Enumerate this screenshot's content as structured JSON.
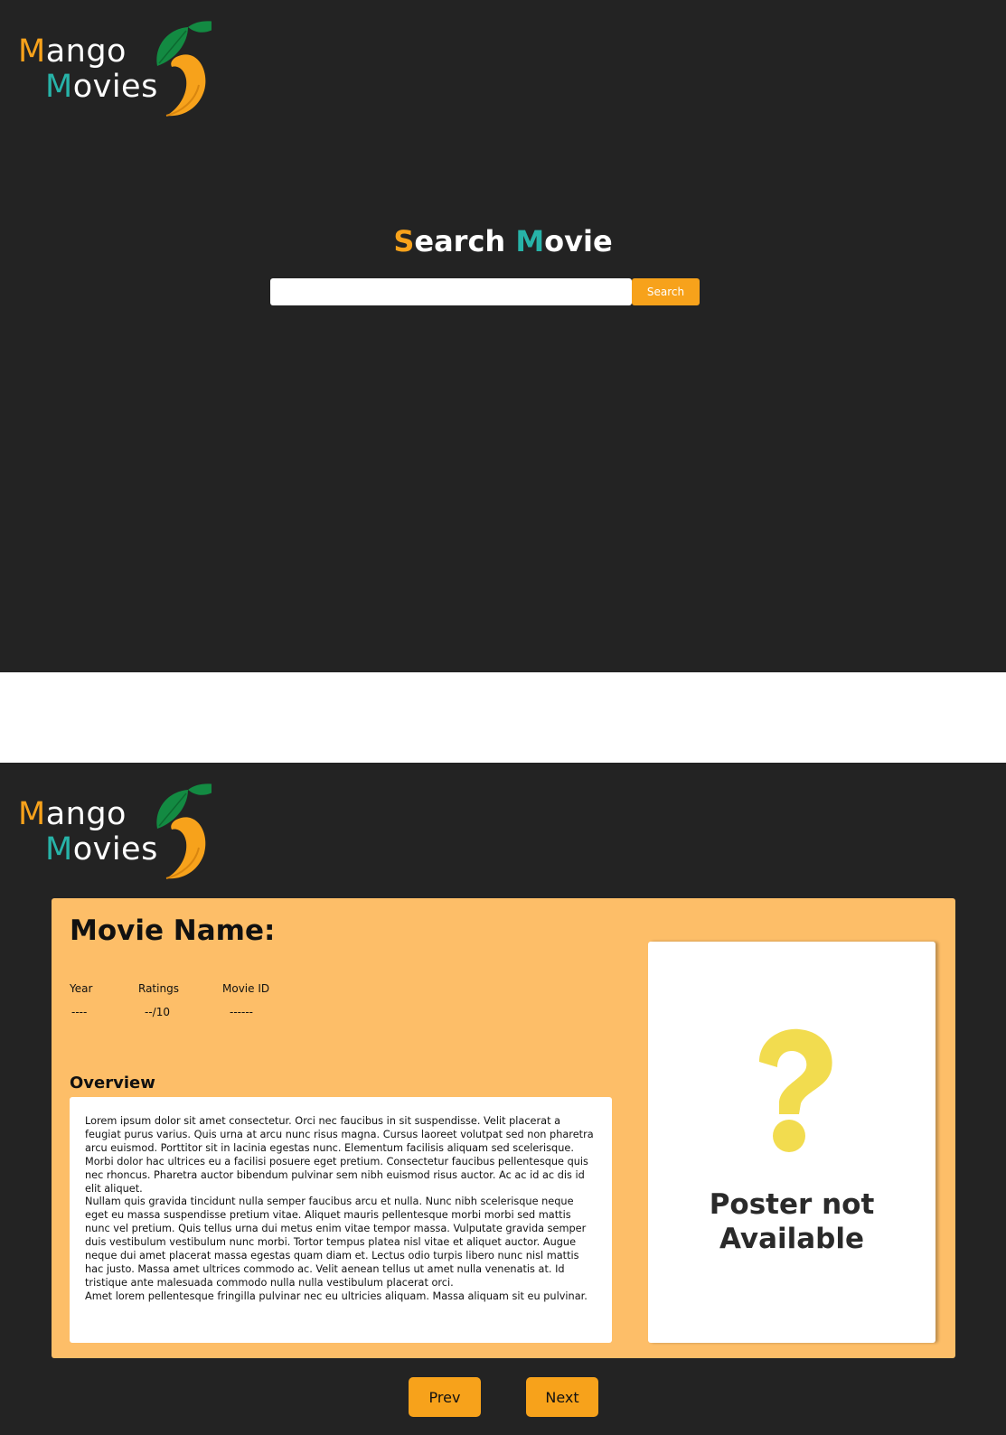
{
  "brand": {
    "line1_initial": "M",
    "line1_rest": "ango",
    "line2_initial": "M",
    "line2_rest": "ovies",
    "colors": {
      "orange": "#f7a21b",
      "teal": "#27b3a8",
      "leaf": "#138a42",
      "background": "#232323"
    },
    "icon": "mango-logo-icon"
  },
  "search_screen": {
    "title_initial_1": "S",
    "title_rest_1": "earch ",
    "title_initial_2": "M",
    "title_rest_2": "ovie",
    "input_value": "",
    "input_placeholder": "",
    "button_label": "Search"
  },
  "detail_screen": {
    "movie_name_label": "Movie Name:",
    "meta": {
      "year_label": "Year",
      "year_value": "----",
      "ratings_label": "Ratings",
      "ratings_value": "--/10",
      "id_label": "Movie ID",
      "id_value": "------"
    },
    "overview_label": "Overview",
    "overview_paragraphs": [
      "Lorem ipsum dolor sit amet consectetur. Orci nec faucibus in sit suspendisse. Velit placerat a feugiat purus varius. Quis urna at arcu nunc risus magna. Cursus laoreet volutpat sed non pharetra arcu euismod. Porttitor sit in lacinia egestas nunc. Elementum facilisis aliquam sed scelerisque. Morbi dolor hac ultrices eu a facilisi posuere eget pretium. Consectetur faucibus pellentesque quis nec rhoncus. Pharetra auctor bibendum pulvinar sem nibh euismod risus auctor. Ac ac id ac dis id elit aliquet.",
      "Nullam quis gravida tincidunt nulla semper faucibus arcu et nulla. Nunc nibh scelerisque neque eget eu massa suspendisse pretium vitae. Aliquet mauris pellentesque morbi morbi sed mattis nunc vel pretium. Quis tellus urna dui metus enim vitae tempor massa. Vulputate gravida semper duis vestibulum vestibulum nunc morbi. Tortor tempus platea nisl vitae et aliquet auctor. Augue neque dui amet placerat massa egestas quam diam et. Lectus odio turpis libero nunc nisl mattis hac justo. Massa amet ultrices commodo ac. Velit aenean tellus ut amet nulla venenatis at. Id tristique ante malesuada commodo nulla nulla vestibulum placerat orci.",
      "Amet lorem pellentesque fringilla pulvinar nec eu ultricies aliquam. Massa aliquam sit eu pulvinar."
    ],
    "poster": {
      "icon": "question-mark-icon",
      "icon_color": "#f2dc4f",
      "line1": "Poster not",
      "line2": "Available"
    },
    "prev_label": "Prev",
    "next_label": "Next",
    "card_color": "#fdbe68"
  }
}
